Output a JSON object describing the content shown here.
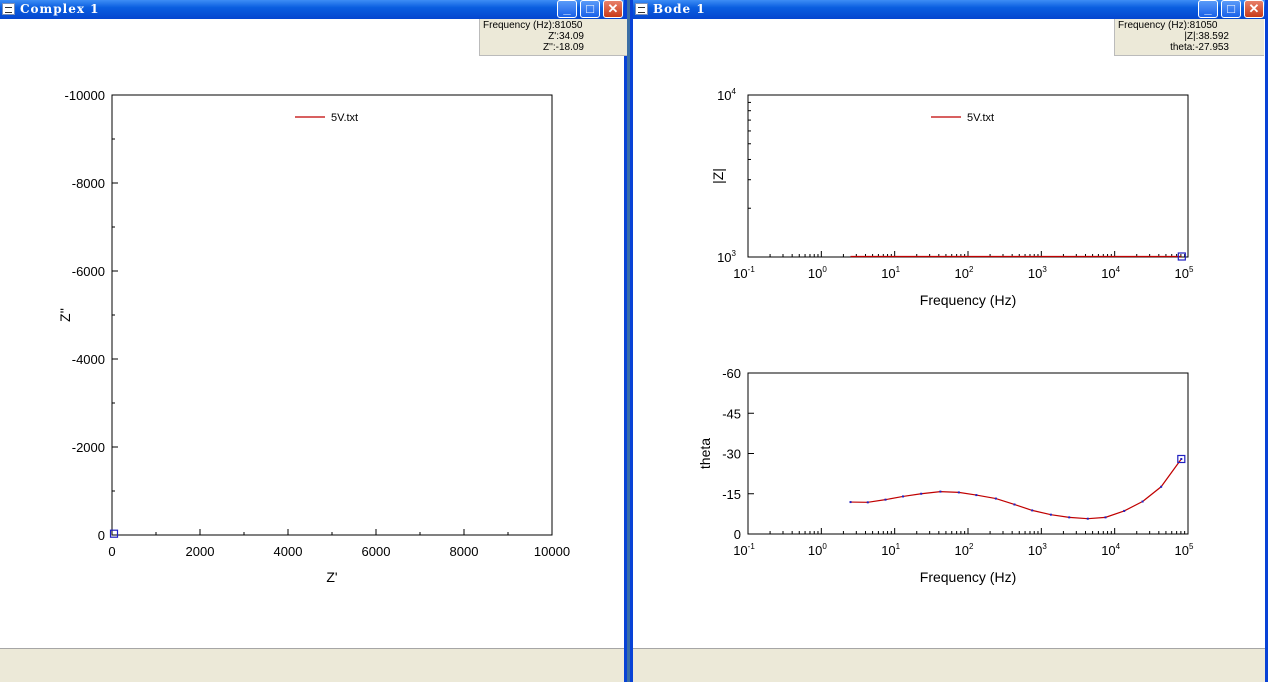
{
  "complex_window": {
    "title": "Complex 1",
    "readout": {
      "line1": "Frequency (Hz):81050",
      "line2": "Z':34.09",
      "line3": "Z'':-18.09"
    }
  },
  "bode_window": {
    "title": "Bode 1",
    "readout": {
      "line1": "Frequency (Hz):81050",
      "line2": "|Z|:38.592",
      "line3": "theta:-27.953"
    }
  },
  "window_controls": {
    "minimize_icon": "minimize-icon",
    "maximize_icon": "maximize-icon",
    "close_icon": "close-icon"
  },
  "chart_data": [
    {
      "type": "line",
      "name": "nyquist",
      "xlabel": "Z'",
      "ylabel": "Z''",
      "xlim": [
        0,
        10000
      ],
      "ylim": [
        0,
        -10000
      ],
      "xticks": [
        "0",
        "2000",
        "4000",
        "6000",
        "8000",
        "10000"
      ],
      "yticks": [
        "-10000",
        "-8000",
        "-6000",
        "-4000",
        "-2000",
        "0"
      ],
      "legend": "5V.txt",
      "legend_position": "top-center",
      "series_color": "#c00000",
      "marker_point": {
        "x": 34.09,
        "y": -18.09
      }
    },
    {
      "type": "line",
      "name": "bode-magnitude",
      "xlabel": "Frequency (Hz)",
      "ylabel": "|Z|",
      "x_scale": "log",
      "xlim": [
        0.1,
        100000
      ],
      "y_scale": "log",
      "ylim": [
        1000,
        10000
      ],
      "xticks": [
        {
          "base": "10",
          "exp": "-1"
        },
        {
          "base": "10",
          "exp": "0"
        },
        {
          "base": "10",
          "exp": "1"
        },
        {
          "base": "10",
          "exp": "2"
        },
        {
          "base": "10",
          "exp": "3"
        },
        {
          "base": "10",
          "exp": "4"
        },
        {
          "base": "10",
          "exp": "5"
        }
      ],
      "yticks": [
        {
          "base": "10",
          "exp": "3"
        },
        {
          "base": "10",
          "exp": "4"
        }
      ],
      "legend": "5V.txt",
      "legend_position": "top-center",
      "series_color": "#c00000",
      "marker_point": {
        "x": 81050,
        "y": 1000
      }
    },
    {
      "type": "line",
      "name": "bode-phase",
      "xlabel": "Frequency (Hz)",
      "ylabel": "theta",
      "x_scale": "log",
      "xlim": [
        0.1,
        100000
      ],
      "ylim": [
        0,
        -60
      ],
      "xticks": [
        {
          "base": "10",
          "exp": "-1"
        },
        {
          "base": "10",
          "exp": "0"
        },
        {
          "base": "10",
          "exp": "1"
        },
        {
          "base": "10",
          "exp": "2"
        },
        {
          "base": "10",
          "exp": "3"
        },
        {
          "base": "10",
          "exp": "4"
        },
        {
          "base": "10",
          "exp": "5"
        }
      ],
      "yticks": [
        "-60",
        "-45",
        "-30",
        "-15",
        "0"
      ],
      "series_color": "#c00000",
      "point_color": "#2020c0",
      "x": [
        2.5,
        4.3,
        7.5,
        13,
        23,
        42,
        75,
        130,
        240,
        430,
        750,
        1350,
        2400,
        4300,
        7500,
        13500,
        24000,
        43000,
        81050
      ],
      "values": [
        -11.9,
        -11.8,
        -12.8,
        -14.0,
        -15.0,
        -15.8,
        -15.5,
        -14.5,
        -13.2,
        -11.0,
        -8.8,
        -7.2,
        -6.2,
        -5.7,
        -6.2,
        -8.6,
        -12.1,
        -17.6,
        -27.953
      ],
      "marker_point": {
        "x": 81050,
        "y": -27.953
      }
    }
  ]
}
